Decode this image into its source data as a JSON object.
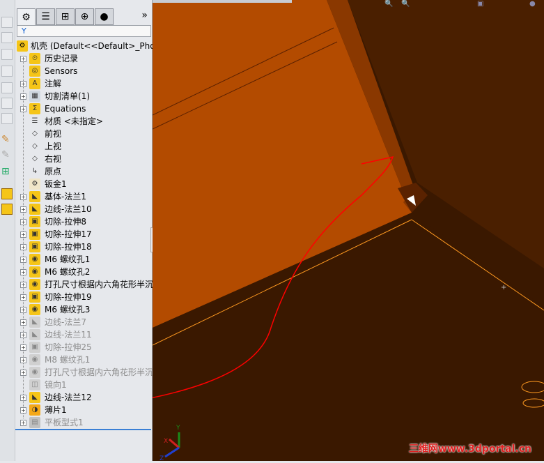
{
  "panel": {
    "tabs": [
      {
        "icon": "feature-manager-icon",
        "glyph": "⚙"
      },
      {
        "icon": "property-manager-icon",
        "glyph": "☰"
      },
      {
        "icon": "configuration-manager-icon",
        "glyph": "⊞"
      },
      {
        "icon": "dimxpert-icon",
        "glyph": "⊕"
      },
      {
        "icon": "display-manager-icon",
        "glyph": "●"
      }
    ],
    "more": "»",
    "filter_icon": "Y",
    "root": "机壳  (Default<<Default>_Pho",
    "items": [
      {
        "label": "历史记录",
        "icon": "history-icon",
        "glyph": "⏲",
        "expand": true,
        "dim": false,
        "color": "#f5c518"
      },
      {
        "label": "Sensors",
        "icon": "sensors-icon",
        "glyph": "◎",
        "expand": false,
        "dim": false,
        "color": "#f5c518"
      },
      {
        "label": "注解",
        "icon": "annotations-icon",
        "glyph": "A",
        "expand": true,
        "dim": false,
        "color": "#f5c518"
      },
      {
        "label": "切割清单(1)",
        "icon": "cut-list-icon",
        "glyph": "▦",
        "expand": true,
        "dim": false,
        "color": "#cfd8e0"
      },
      {
        "label": "Equations",
        "icon": "equations-icon",
        "glyph": "Σ",
        "expand": true,
        "dim": false,
        "color": "#f5c518"
      },
      {
        "label": "材质 <未指定>",
        "icon": "material-icon",
        "glyph": "☰",
        "expand": false,
        "dim": false,
        "color": "transparent"
      },
      {
        "label": "前视",
        "icon": "plane-icon",
        "glyph": "◇",
        "expand": false,
        "dim": false,
        "color": "transparent"
      },
      {
        "label": "上视",
        "icon": "plane-icon",
        "glyph": "◇",
        "expand": false,
        "dim": false,
        "color": "transparent"
      },
      {
        "label": "右视",
        "icon": "plane-icon",
        "glyph": "◇",
        "expand": false,
        "dim": false,
        "color": "transparent"
      },
      {
        "label": "原点",
        "icon": "origin-icon",
        "glyph": "↳",
        "expand": false,
        "dim": false,
        "color": "transparent"
      },
      {
        "label": "钣金1",
        "icon": "sheet-metal-icon",
        "glyph": "⚙",
        "expand": false,
        "dim": false,
        "color": "#f0e6c8"
      },
      {
        "label": "基体-法兰1",
        "icon": "base-flange-icon",
        "glyph": "◣",
        "expand": true,
        "dim": false,
        "color": "#f5c518"
      },
      {
        "label": "边线-法兰10",
        "icon": "edge-flange-icon",
        "glyph": "◣",
        "expand": true,
        "dim": false,
        "color": "#f5c518"
      },
      {
        "label": "切除-拉伸8",
        "icon": "cut-extrude-icon",
        "glyph": "▣",
        "expand": true,
        "dim": false,
        "color": "#f5c518"
      },
      {
        "label": "切除-拉伸17",
        "icon": "cut-extrude-icon",
        "glyph": "▣",
        "expand": true,
        "dim": false,
        "color": "#f5c518"
      },
      {
        "label": "切除-拉伸18",
        "icon": "cut-extrude-icon",
        "glyph": "▣",
        "expand": true,
        "dim": false,
        "color": "#f5c518"
      },
      {
        "label": "M6 螺纹孔1",
        "icon": "hole-wizard-icon",
        "glyph": "◉",
        "expand": true,
        "dim": false,
        "color": "#f5c518"
      },
      {
        "label": "M6 螺纹孔2",
        "icon": "hole-wizard-icon",
        "glyph": "◉",
        "expand": true,
        "dim": false,
        "color": "#f5c518"
      },
      {
        "label": "打孔尺寸根据内六角花形半沉",
        "icon": "hole-wizard-icon",
        "glyph": "◉",
        "expand": true,
        "dim": false,
        "color": "#f5c518"
      },
      {
        "label": "切除-拉伸19",
        "icon": "cut-extrude-icon",
        "glyph": "▣",
        "expand": true,
        "dim": false,
        "color": "#f5c518"
      },
      {
        "label": "M6 螺纹孔3",
        "icon": "hole-wizard-icon",
        "glyph": "◉",
        "expand": true,
        "dim": false,
        "color": "#f5c518"
      },
      {
        "label": "边线-法兰7",
        "icon": "edge-flange-icon",
        "glyph": "◣",
        "expand": true,
        "dim": true,
        "color": "#d0d0d0"
      },
      {
        "label": "边线-法兰11",
        "icon": "edge-flange-icon",
        "glyph": "◣",
        "expand": true,
        "dim": true,
        "color": "#d0d0d0"
      },
      {
        "label": "切除-拉伸25",
        "icon": "cut-extrude-icon",
        "glyph": "▣",
        "expand": true,
        "dim": true,
        "color": "#d0d0d0"
      },
      {
        "label": "M8 螺纹孔1",
        "icon": "hole-wizard-icon",
        "glyph": "◉",
        "expand": true,
        "dim": true,
        "color": "#d0d0d0"
      },
      {
        "label": "打孔尺寸根据内六角花形半沉",
        "icon": "hole-wizard-icon",
        "glyph": "◉",
        "expand": true,
        "dim": true,
        "color": "#d0d0d0"
      },
      {
        "label": "镜向1",
        "icon": "mirror-icon",
        "glyph": "◫",
        "expand": false,
        "dim": true,
        "color": "#d0d0d0"
      },
      {
        "label": "边线-法兰12",
        "icon": "edge-flange-icon",
        "glyph": "◣",
        "expand": true,
        "dim": false,
        "color": "#f5c518"
      },
      {
        "label": "薄片1",
        "icon": "tab-feature-icon",
        "glyph": "◑",
        "expand": true,
        "dim": false,
        "color": "#f5a818"
      },
      {
        "label": "平板型式1",
        "icon": "flat-pattern-icon",
        "glyph": "▤",
        "expand": true,
        "dim": true,
        "color": "#c0c0c0"
      }
    ]
  },
  "viewport": {
    "colors": {
      "wall_left": "#b34b00",
      "wall_right": "#4a1f00",
      "floor": "#3a1800",
      "edge_highlight": "#ff9a20",
      "annotation": "#ff0000"
    },
    "triad": {
      "x": "X",
      "y": "Y",
      "z": "Z"
    },
    "watermark": "三维网www.3dportal.cn"
  }
}
